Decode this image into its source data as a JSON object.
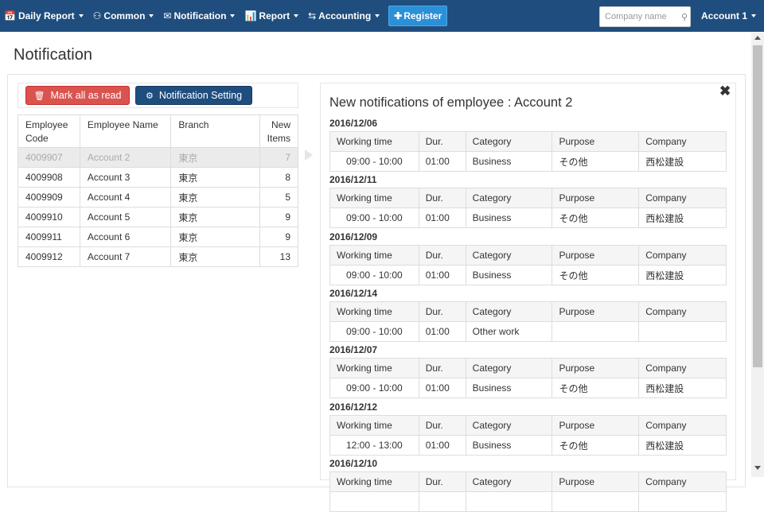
{
  "colors": {
    "navbar": "#1f4e7e",
    "register": "#2a90d8",
    "danger": "#d9534f",
    "primary": "#1f4e7e"
  },
  "nav": {
    "items": [
      {
        "icon": "calendar-icon",
        "glyph": "📅",
        "label": "Daily Report"
      },
      {
        "icon": "sitemap-icon",
        "glyph": "⚇",
        "label": "Common"
      },
      {
        "icon": "envelope-icon",
        "glyph": "✉",
        "label": "Notification"
      },
      {
        "icon": "bar-chart-icon",
        "glyph": "📊",
        "label": "Report"
      },
      {
        "icon": "exchange-icon",
        "glyph": "⇆",
        "label": "Accounting"
      }
    ],
    "register": {
      "icon": "plus-icon",
      "glyph": "✚",
      "label": "Register"
    },
    "search_placeholder": "Company name",
    "search_icon": "⚲",
    "account": "Account 1"
  },
  "page_title": "Notification",
  "buttons": {
    "mark_all": {
      "icon": "trash-icon",
      "glyph": "🗑",
      "label": "Mark all as read"
    },
    "setting": {
      "icon": "gear-icon",
      "glyph": "⚙",
      "label": "Notification Setting"
    }
  },
  "employees": {
    "headers": [
      "Employee Code",
      "Employee Name",
      "Branch",
      "New Items"
    ],
    "rows": [
      {
        "code": "4009907",
        "name": "Account 2",
        "branch": "東京",
        "count": "7",
        "selected": true
      },
      {
        "code": "4009908",
        "name": "Account 3",
        "branch": "東京",
        "count": "8",
        "selected": false
      },
      {
        "code": "4009909",
        "name": "Account 4",
        "branch": "東京",
        "count": "5",
        "selected": false
      },
      {
        "code": "4009910",
        "name": "Account 5",
        "branch": "東京",
        "count": "9",
        "selected": false
      },
      {
        "code": "4009911",
        "name": "Account 6",
        "branch": "東京",
        "count": "9",
        "selected": false
      },
      {
        "code": "4009912",
        "name": "Account 7",
        "branch": "東京",
        "count": "13",
        "selected": false
      }
    ]
  },
  "notifications": {
    "title": "New notifications of employee : Account 2",
    "close": "✖",
    "headers": [
      "Working time",
      "Dur.",
      "Category",
      "Purpose",
      "Company"
    ],
    "days": [
      {
        "date": "2016/12/06",
        "time": "09:00 - 10:00",
        "dur": "01:00",
        "category": "Business",
        "purpose": "その他",
        "company": "西松建設"
      },
      {
        "date": "2016/12/11",
        "time": "09:00 - 10:00",
        "dur": "01:00",
        "category": "Business",
        "purpose": "その他",
        "company": "西松建設"
      },
      {
        "date": "2016/12/09",
        "time": "09:00 - 10:00",
        "dur": "01:00",
        "category": "Business",
        "purpose": "その他",
        "company": "西松建設"
      },
      {
        "date": "2016/12/14",
        "time": "09:00 - 10:00",
        "dur": "01:00",
        "category": "Other work",
        "purpose": "",
        "company": ""
      },
      {
        "date": "2016/12/07",
        "time": "09:00 - 10:00",
        "dur": "01:00",
        "category": "Business",
        "purpose": "その他",
        "company": "西松建設"
      },
      {
        "date": "2016/12/12",
        "time": "12:00 - 13:00",
        "dur": "01:00",
        "category": "Business",
        "purpose": "その他",
        "company": "西松建設"
      },
      {
        "date": "2016/12/10",
        "time": "",
        "dur": "",
        "category": "",
        "purpose": "",
        "company": ""
      }
    ]
  }
}
